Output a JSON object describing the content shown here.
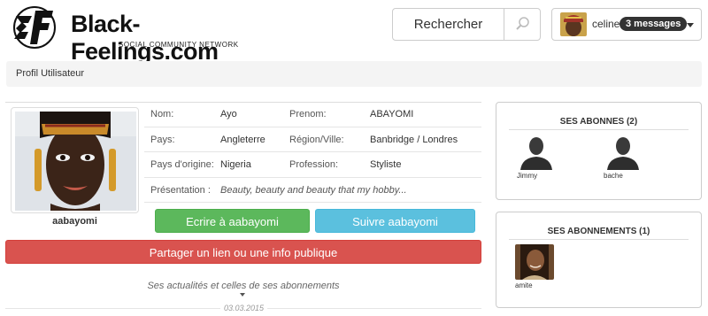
{
  "header": {
    "brand": "Black-Feelings.com",
    "tagline": "SOCIAL COMMUNITY NETWORK",
    "search_label": "Rechercher",
    "user_name": "celine",
    "messages_badge": "3 messages"
  },
  "breadcrumb": "Profil Utilisateur",
  "profile": {
    "username": "aabayomi",
    "rows": [
      {
        "label1": "Nom:",
        "value1": "Ayo",
        "label2": "Prenom:",
        "value2": "ABAYOMI"
      },
      {
        "label1": "Pays:",
        "value1": "Angleterre",
        "label2": "Région/Ville:",
        "value2": "Banbridge / Londres"
      },
      {
        "label1": "Pays d'origine:",
        "value1": "Nigeria",
        "label2": "Profession:",
        "value2": "Styliste"
      }
    ],
    "presentation_label": "Présentation :",
    "presentation_value": "Beauty, beauty and beauty that my hobby..."
  },
  "actions": {
    "write_label": "Ecrire à aabayomi",
    "follow_label": "Suivre aabayomi",
    "share_label": "Partager un lien ou une info publique",
    "write_color": "#5cb85c",
    "follow_color": "#5bc0de",
    "share_color": "#d9534f"
  },
  "news": {
    "label": "Ses actualités et celles de ses abonnements",
    "date": "03.03.2015"
  },
  "subscribers": {
    "title": "SES ABONNES (2)",
    "items": [
      {
        "name": "Jimmy",
        "icon": "person-silhouette-icon"
      },
      {
        "name": "bache",
        "icon": "person-silhouette-icon"
      }
    ]
  },
  "subscriptions": {
    "title": "SES ABONNEMENTS (1)",
    "items": [
      {
        "name": "amite",
        "icon": "photo"
      }
    ]
  }
}
